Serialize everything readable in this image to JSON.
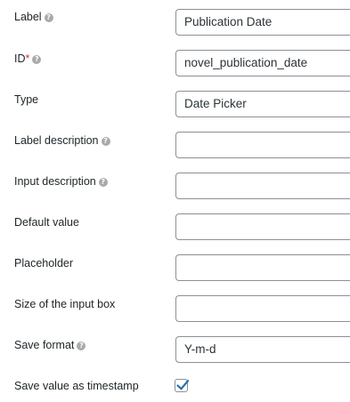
{
  "fields": {
    "label": {
      "label": "Label",
      "help_icon": "question-circle-icon",
      "value": "Publication Date"
    },
    "id": {
      "label": "ID",
      "required_mark": "*",
      "help_icon": "question-circle-icon",
      "value": "novel_publication_date"
    },
    "type": {
      "label": "Type",
      "value": "Date Picker"
    },
    "label_description": {
      "label": "Label description",
      "help_icon": "question-circle-icon",
      "value": ""
    },
    "input_description": {
      "label": "Input description",
      "help_icon": "question-circle-icon",
      "value": ""
    },
    "default_value": {
      "label": "Default value",
      "value": ""
    },
    "placeholder": {
      "label": "Placeholder",
      "value": ""
    },
    "size": {
      "label": "Size of the input box",
      "value": ""
    },
    "save_format": {
      "label": "Save format",
      "help_icon": "question-circle-icon",
      "value": "Y-m-d"
    },
    "timestamp": {
      "label": "Save value as timestamp",
      "checked": true,
      "check_icon": "checkmark-icon"
    }
  },
  "colors": {
    "text": "#1d2327",
    "help_icon": "#a7aaad",
    "required": "#d63638",
    "border": "#8c8f94",
    "accent": "#2271b1"
  }
}
